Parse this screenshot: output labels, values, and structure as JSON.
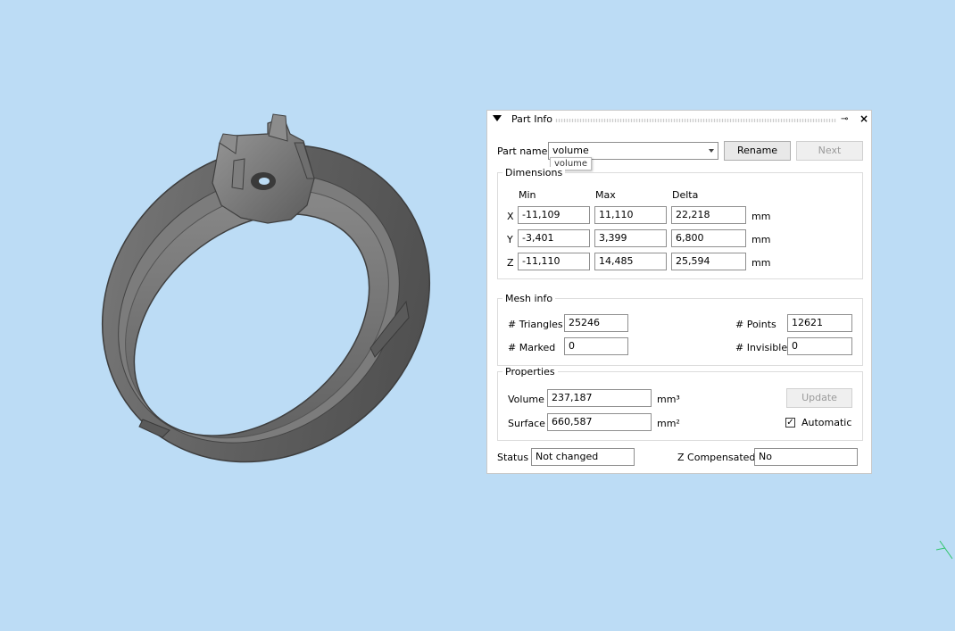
{
  "panel": {
    "title": "Part Info",
    "part_name_label": "Part name",
    "part_name_value": "volume",
    "part_name_tooltip": "volume",
    "rename_label": "Rename",
    "next_label": "Next"
  },
  "dimensions": {
    "title": "Dimensions",
    "headers": [
      "Min",
      "Max",
      "Delta"
    ],
    "unit": "mm",
    "rows": [
      {
        "axis": "X",
        "min": "-11,109",
        "max": "11,110",
        "delta": "22,218"
      },
      {
        "axis": "Y",
        "min": "-3,401",
        "max": "3,399",
        "delta": "6,800"
      },
      {
        "axis": "Z",
        "min": "-11,110",
        "max": "14,485",
        "delta": "25,594"
      }
    ]
  },
  "mesh": {
    "title": "Mesh info",
    "triangles_label": "# Triangles",
    "triangles": "25246",
    "points_label": "# Points",
    "points": "12621",
    "marked_label": "# Marked",
    "marked": "0",
    "invisible_label": "# Invisible",
    "invisible": "0"
  },
  "properties": {
    "title": "Properties",
    "volume_label": "Volume",
    "volume": "237,187",
    "volume_unit": "mm³",
    "surface_label": "Surface",
    "surface": "660,587",
    "surface_unit": "mm²",
    "update_label": "Update",
    "automatic_label": "Automatic",
    "automatic_checked": true
  },
  "status": {
    "status_label": "Status",
    "status_value": "Not changed",
    "zcomp_label": "Z Compensated",
    "zcomp_value": "No"
  },
  "colors": {
    "viewport_bg": "#bcdcf5",
    "ring_body": "#6b6b6b",
    "axis_indicator": "#2fc66a"
  },
  "icons": [
    "collapse-triangle-icon",
    "pin-icon",
    "close-icon",
    "checkbox-check-icon"
  ]
}
